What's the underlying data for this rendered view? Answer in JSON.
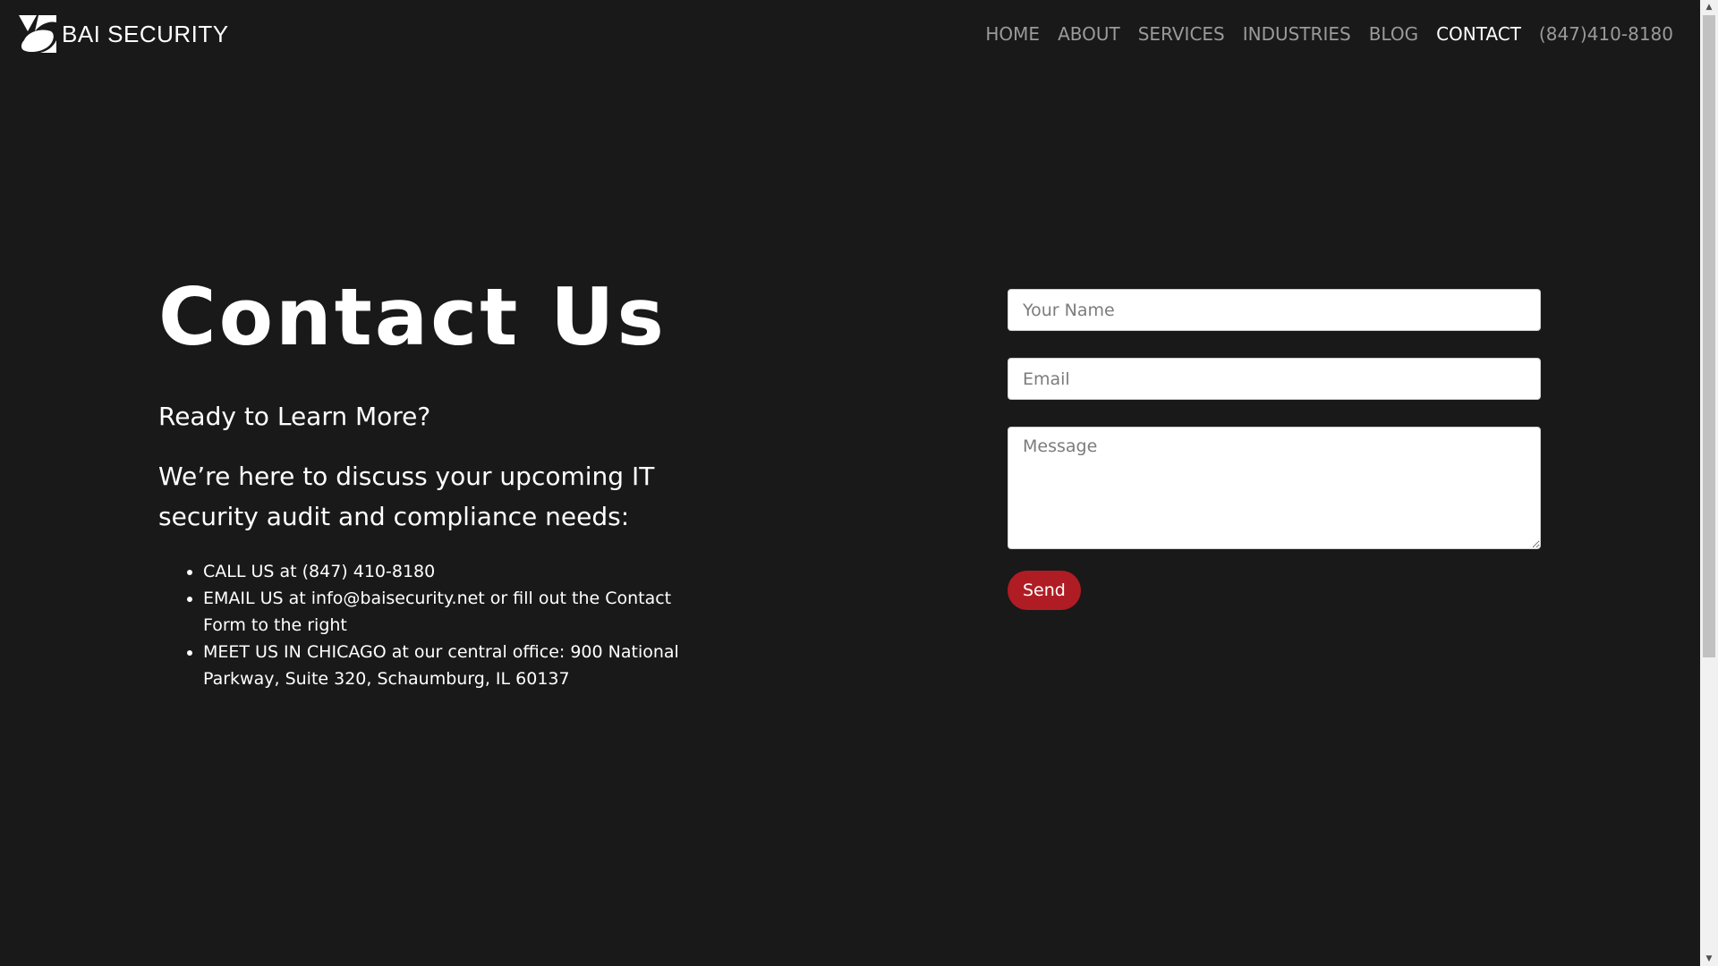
{
  "brand": {
    "name": "BAI SECURITY"
  },
  "nav": {
    "items": [
      {
        "label": "HOME"
      },
      {
        "label": "ABOUT"
      },
      {
        "label": "SERVICES"
      },
      {
        "label": "INDUSTRIES"
      },
      {
        "label": "BLOG"
      },
      {
        "label": "CONTACT",
        "active": true
      },
      {
        "label": "(847)410-8180"
      }
    ]
  },
  "main": {
    "title": "Contact Us",
    "subtitle": "Ready to Learn More?",
    "lead": "We’re here to discuss your upcoming IT security audit and compliance needs:",
    "list": [
      "CALL US at (847) 410-8180",
      "EMAIL US at info@baisecurity.net or fill out the Contact Form to the right",
      "MEET US IN CHICAGO at our central office: 900 National Parkway, Suite 320, Schaumburg, IL 60137"
    ]
  },
  "form": {
    "name_placeholder": "Your Name",
    "name_value": "",
    "email_placeholder": "Email",
    "email_value": "",
    "message_placeholder": "Message",
    "message_value": "",
    "send_label": "Send"
  },
  "colors": {
    "background": "#191919",
    "accent": "#b01c24",
    "nav_text": "#9a9a9a",
    "nav_active": "#ffffff"
  },
  "icons": {
    "logo": "bai-logo-icon",
    "scroll_up": "scroll-up-arrow-icon",
    "scroll_down": "scroll-down-arrow-icon"
  }
}
